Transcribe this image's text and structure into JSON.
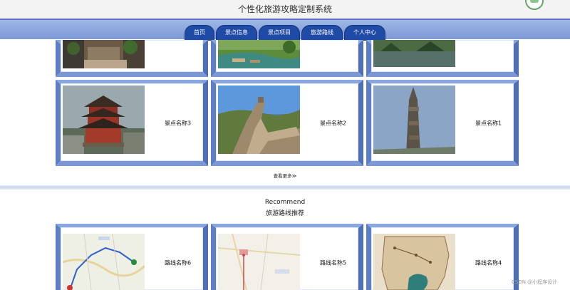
{
  "header": {
    "title": "个性化旅游攻略定制系统"
  },
  "nav": {
    "items": [
      "首页",
      "景点信息",
      "景点项目",
      "旅游路线",
      "个人中心"
    ]
  },
  "attractions": {
    "top_row": [
      {
        "name": "",
        "image": "street-photo"
      },
      {
        "name": "",
        "image": "river-photo"
      },
      {
        "name": "",
        "image": "lake-photo"
      }
    ],
    "cards": [
      {
        "name": "景点名称3",
        "image": "pavilion-photo"
      },
      {
        "name": "景点名称2",
        "image": "great-wall-photo"
      },
      {
        "name": "景点名称1",
        "image": "totem-photo"
      }
    ],
    "more_label": "查看更多≫"
  },
  "recommend": {
    "title_en": "Recommend",
    "title_cn": "旅游路线推荐",
    "routes": [
      {
        "name": "路线名称6",
        "image": "route-map"
      },
      {
        "name": "路线名称5",
        "image": "route-map"
      },
      {
        "name": "路线名称4",
        "image": "old-map"
      }
    ]
  },
  "watermark": "CSDN @小程序设计",
  "colors": {
    "nav_tab": "#1f4aa6",
    "nav_bar": "#8ba6de",
    "card_frame": "#6f8fd0"
  }
}
